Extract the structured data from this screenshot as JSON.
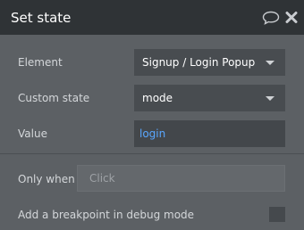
{
  "header": {
    "title": "Set state",
    "comment_icon": "speech-bubble-icon",
    "close_icon": "close-icon"
  },
  "form": {
    "element_label": "Element",
    "element_value": "Signup / Login Popup",
    "custom_state_label": "Custom state",
    "custom_state_value": "mode",
    "value_label": "Value",
    "value_value": "login",
    "only_when_label": "Only when",
    "only_when_placeholder": "Click",
    "breakpoint_label": "Add a breakpoint in debug mode",
    "breakpoint_checked": false
  },
  "colors": {
    "header_bg": "#2f3336",
    "panel_bg": "#5c6064",
    "value_text": "#59a7ff"
  }
}
